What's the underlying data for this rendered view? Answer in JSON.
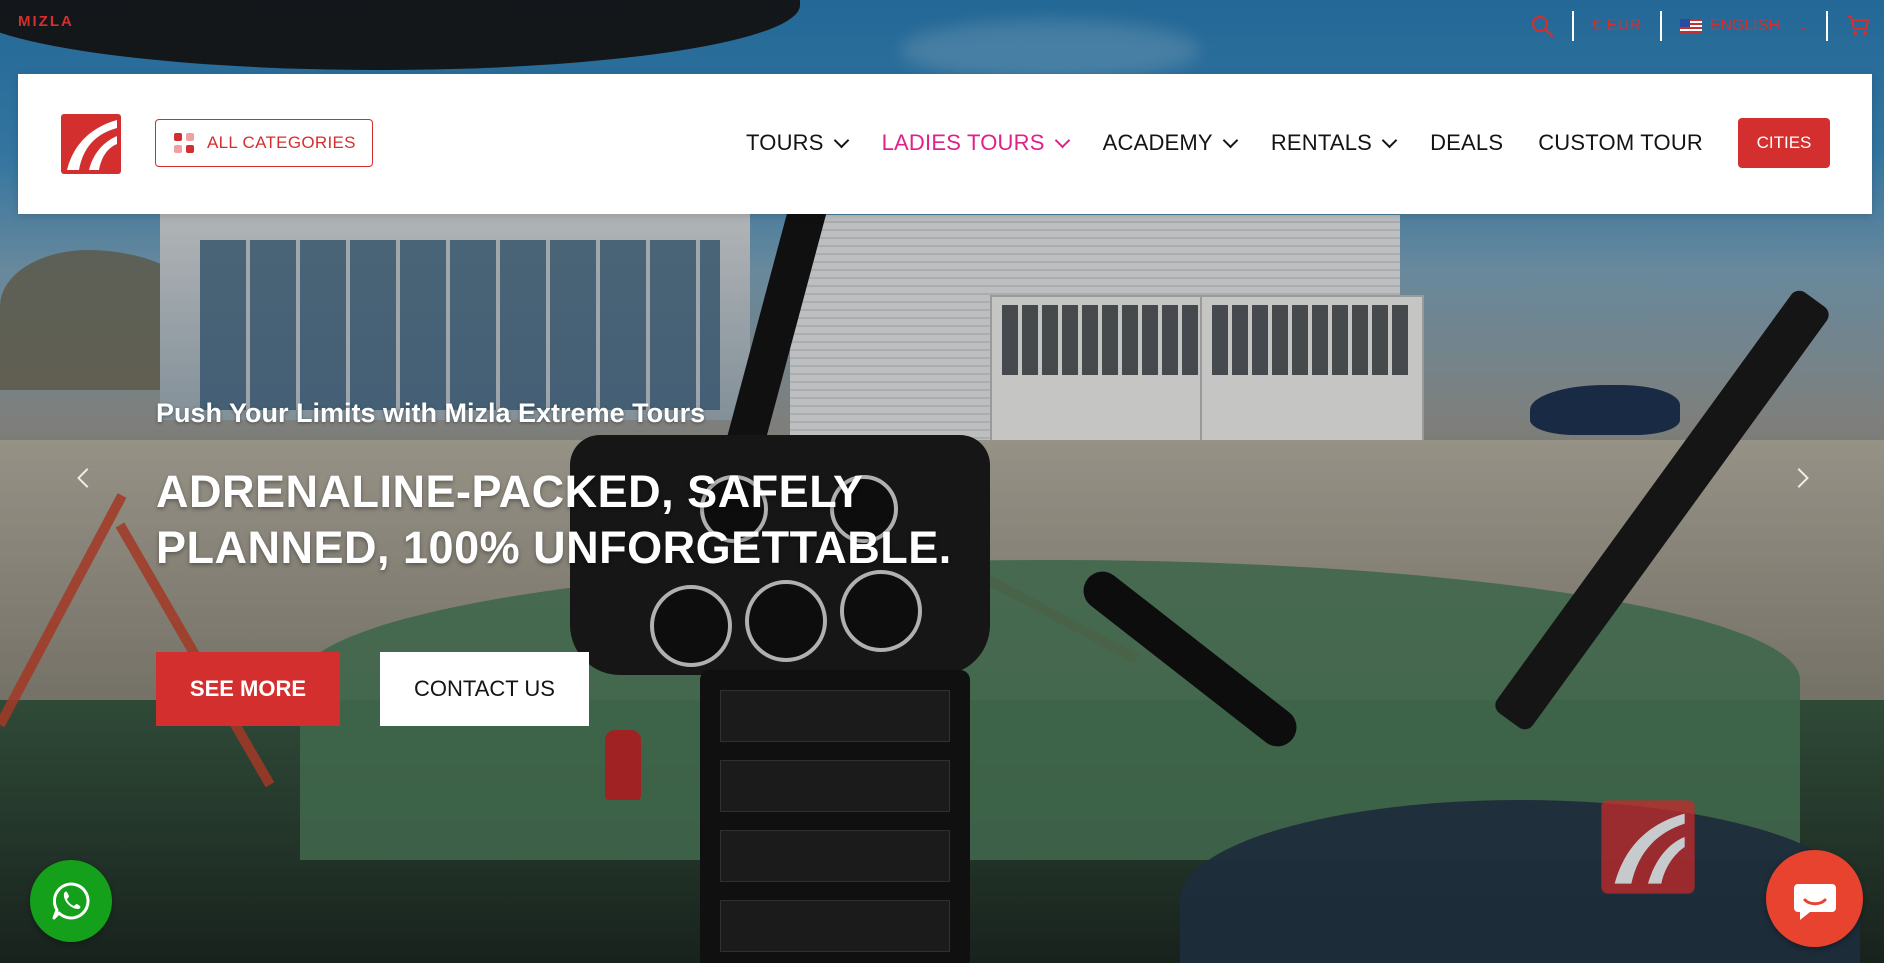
{
  "brand": {
    "small_name": "MIZLA"
  },
  "utility": {
    "currency": "€ EUR",
    "language": "ENGLISH",
    "search_icon": "search-icon",
    "cart_icon": "cart-icon"
  },
  "nav": {
    "all_categories": "ALL CATEGORIES",
    "items": [
      {
        "label": "TOURS",
        "dropdown": true
      },
      {
        "label": "LADIES TOURS",
        "dropdown": true
      },
      {
        "label": "ACADEMY",
        "dropdown": true
      },
      {
        "label": "RENTALS",
        "dropdown": true
      },
      {
        "label": "DEALS",
        "dropdown": false
      },
      {
        "label": "CUSTOM TOUR",
        "dropdown": false
      }
    ],
    "cities": "CITIES"
  },
  "hero": {
    "kicker": "Push Your Limits with Mizla Extreme Tours",
    "headline": "ADRENALINE-PACKED, SAFELY PLANNED, 100% UNFORGETTABLE.",
    "see_more": "SEE MORE",
    "contact": "CONTACT US"
  },
  "colors": {
    "brand_red": "#d42f2f",
    "active_pink": "#e0218a",
    "whatsapp_green": "#14a01a",
    "chat_orange": "#e8432f"
  }
}
